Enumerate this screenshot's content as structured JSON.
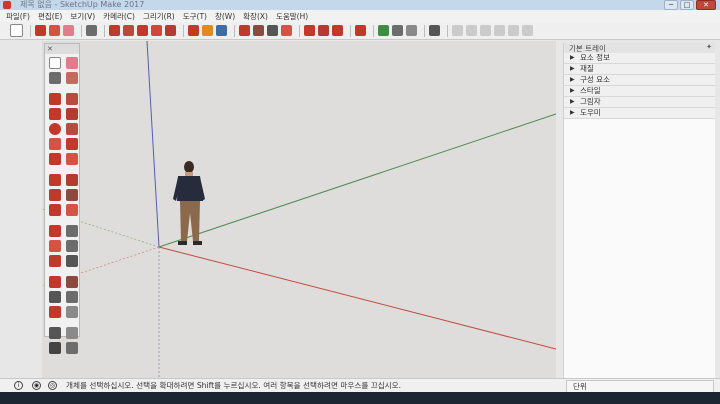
{
  "window": {
    "title": "제목 없음 - SketchUp Make 2017",
    "buttons": [
      "─",
      "□",
      "✕"
    ]
  },
  "menu": [
    "파일(F)",
    "편집(E)",
    "보기(V)",
    "카메라(C)",
    "그리기(R)",
    "도구(T)",
    "창(W)",
    "확장(X)",
    "도움말(H)"
  ],
  "toolbar": {
    "icons": [
      "select-arrow-icon",
      "pencil-icon",
      "shape-icon",
      "eraser-icon",
      "paint-bucket-icon",
      "pushpull-icon",
      "move-icon",
      "rotate-icon",
      "offset-icon",
      "tape-measure-icon",
      "text-icon",
      "paint-icon",
      "orbit-icon",
      "pan-icon",
      "zoom-icon",
      "zoom-extents-icon",
      "warehouse-icon",
      "extension-icon",
      "share-icon",
      "model-info-icon",
      "camera-icon",
      "layer-icon",
      "scenes-icon",
      "section-icon",
      "view-icon",
      "view-icon",
      "view-icon",
      "view-icon",
      "view-icon"
    ],
    "colors": {
      "red": "#c0392b",
      "grey": "#6c6c6c",
      "green": "#3e8e41",
      "blue": "#3a6ea5",
      "orange": "#e28a1f"
    }
  },
  "tool_palette": {
    "close_glyph": "✕",
    "tools": [
      "select-icon",
      "eraser-icon",
      "paint-bucket-icon",
      "component-icon",
      "line-icon",
      "freehand-icon",
      "rectangle-icon",
      "rotated-rectangle-icon",
      "circle-icon",
      "polygon-icon",
      "arc-icon",
      "two-point-arc-icon",
      "three-point-arc-icon",
      "pie-icon",
      "move-icon",
      "pushpull-icon",
      "rotate-icon",
      "follow-me-icon",
      "scale-icon",
      "offset-icon",
      "tape-measure-icon",
      "dimension-icon",
      "protractor-icon",
      "text-icon",
      "axes-icon",
      "3d-text-icon",
      "orbit-icon",
      "pan-icon",
      "zoom-icon",
      "zoom-window-icon",
      "zoom-extents-icon",
      "previous-view-icon",
      "position-camera-icon",
      "walk-icon",
      "look-around-icon",
      "section-plane-icon"
    ]
  },
  "tray": {
    "title": "기본 트레이",
    "pin_glyph": "✦",
    "items": [
      "요소 정보",
      "재질",
      "구성 요소",
      "스타일",
      "그림자",
      "도우미"
    ]
  },
  "status": {
    "message": "개체를 선택하십시오. 선택을 확대하려면 Shift를 누르십시오. 여러 항목을 선택하려면 마우스를 끄십시오.",
    "unit_label": "단위",
    "icons": [
      "info-circle-icon",
      "geo-location-icon",
      "credits-icon"
    ]
  },
  "colors": {
    "viewport_bg": "#dedddb",
    "axis_red": "#c14a3e",
    "axis_green": "#4f8a4d",
    "axis_blue": "#4f5fb0"
  }
}
